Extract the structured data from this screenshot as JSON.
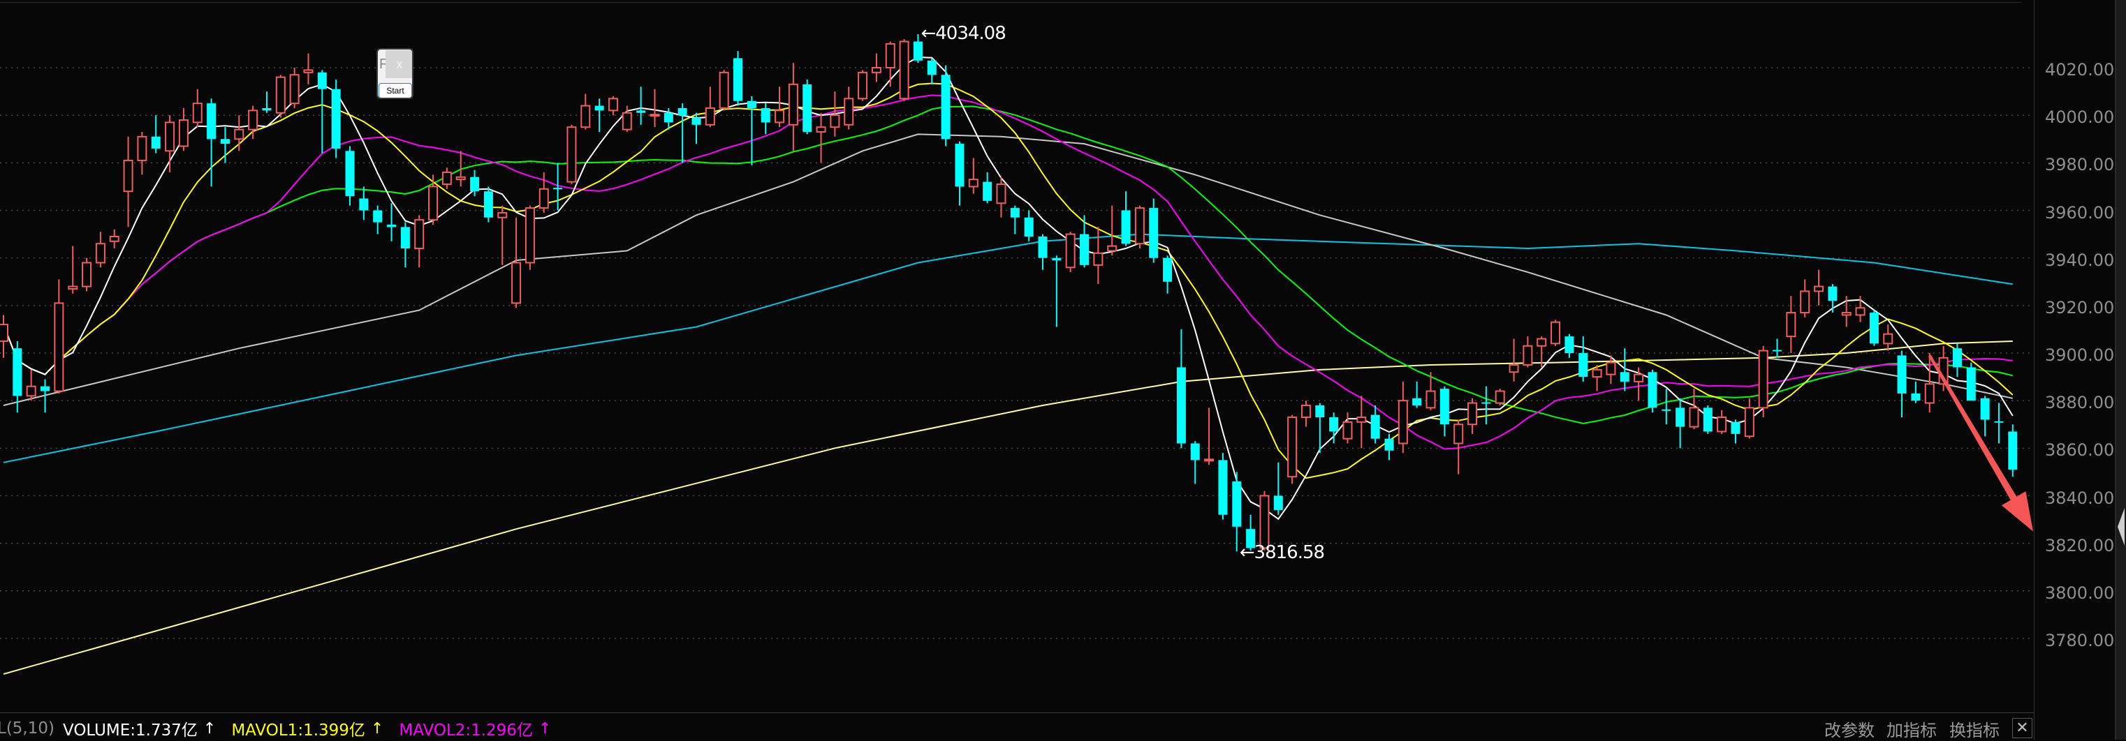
{
  "chart_data": {
    "type": "candlestick",
    "y_axis": {
      "ticks": [
        "4020.00",
        "4000.00",
        "3980.00",
        "3960.00",
        "3940.00",
        "3920.00",
        "3900.00",
        "3880.00",
        "3860.00",
        "3840.00",
        "3820.00",
        "3800.00",
        "3780.00"
      ],
      "tick_values": [
        4020,
        4000,
        3980,
        3960,
        3940,
        3920,
        3900,
        3880,
        3860,
        3840,
        3820,
        3800,
        3780
      ],
      "position": "right",
      "grid": "dotted"
    },
    "ylim": [
      3766,
      4048
    ],
    "colors": {
      "up": "#f25c5c",
      "down": "#00ffff",
      "ma5": "#ffffff",
      "ma10": "#ffff00",
      "ma20": "#ff00ff",
      "ma30": "#00ff00",
      "ma60": "#c8c8c8",
      "ma120": "#00c8e6",
      "ma250": "#ffff90",
      "arrow": "#f55555"
    },
    "ohlc_format": [
      "open",
      "high",
      "low",
      "close"
    ],
    "ohlc": [
      [
        3905,
        3916,
        3898,
        3912
      ],
      [
        3902,
        3905,
        3875,
        3882
      ],
      [
        3882,
        3893,
        3880,
        3886
      ],
      [
        3886,
        3889,
        3875,
        3884
      ],
      [
        3884,
        3931,
        3883,
        3921
      ],
      [
        3927,
        3945,
        3925,
        3928
      ],
      [
        3928,
        3940,
        3926,
        3938
      ],
      [
        3938,
        3951,
        3936,
        3946
      ],
      [
        3947,
        3952,
        3944,
        3949
      ],
      [
        3968,
        3991,
        3953,
        3981
      ],
      [
        3981,
        3993,
        3975,
        3991
      ],
      [
        3991,
        4000,
        3984,
        3986
      ],
      [
        3985,
        4000,
        3976,
        3997
      ],
      [
        3987,
        4003,
        3985,
        3998
      ],
      [
        3997,
        4011,
        3995,
        4005
      ],
      [
        4005,
        4007,
        3970,
        3990
      ],
      [
        3990,
        3995,
        3980,
        3988
      ],
      [
        3990,
        4000,
        3985,
        3994
      ],
      [
        3994,
        4004,
        3990,
        4002
      ],
      [
        4003,
        4010,
        4001,
        4002
      ],
      [
        4001,
        4017,
        3999,
        4016
      ],
      [
        4005,
        4020,
        4003,
        4017
      ],
      [
        4018,
        4026,
        4013,
        4019
      ],
      [
        4018,
        4019,
        3984,
        4011
      ],
      [
        4011,
        4015,
        3982,
        3986
      ],
      [
        3985,
        3987,
        3962,
        3966
      ],
      [
        3965,
        3970,
        3956,
        3960
      ],
      [
        3960,
        3962,
        3950,
        3955
      ],
      [
        3954,
        3963,
        3947,
        3953
      ],
      [
        3953,
        3955,
        3936,
        3944
      ],
      [
        3944,
        3958,
        3936,
        3956
      ],
      [
        3956,
        3975,
        3954,
        3970
      ],
      [
        3971,
        3978,
        3969,
        3976
      ],
      [
        3973,
        3985,
        3970,
        3974
      ],
      [
        3974,
        3977,
        3966,
        3968
      ],
      [
        3968,
        3970,
        3955,
        3957
      ],
      [
        3957,
        3962,
        3937,
        3959
      ],
      [
        3921,
        3957,
        3919,
        3938
      ],
      [
        3938,
        3962,
        3935,
        3961
      ],
      [
        3961,
        3976,
        3959,
        3969
      ],
      [
        3969.5,
        3980,
        3960,
        3969
      ],
      [
        3972,
        3996,
        3971,
        3995
      ],
      [
        3995,
        4009,
        3994,
        4004
      ],
      [
        4004,
        4007,
        3993,
        4002
      ],
      [
        4002,
        4008,
        4000,
        4007
      ],
      [
        3994,
        4004,
        3993,
        4001
      ],
      [
        4002,
        4012,
        3996,
        4001
      ],
      [
        4000,
        4011,
        3995,
        4000.3
      ],
      [
        4001,
        4003,
        3994,
        3997
      ],
      [
        4003,
        4005,
        3980,
        4000
      ],
      [
        3999,
        4001,
        3988,
        3996
      ],
      [
        3996,
        4012,
        3995,
        4003
      ],
      [
        4003,
        4019,
        4002,
        4018
      ],
      [
        4024,
        4027,
        4004,
        4006
      ],
      [
        4006,
        4008,
        3979,
        4003
      ],
      [
        4003,
        4005,
        3992,
        3997
      ],
      [
        3997,
        4012,
        3995,
        4002
      ],
      [
        3996,
        4022,
        3985,
        4013
      ],
      [
        4013,
        4015,
        3992,
        3993
      ],
      [
        3993,
        4001,
        3980,
        3995
      ],
      [
        3995,
        4010,
        3991,
        4000
      ],
      [
        3996,
        4012,
        3994,
        4007
      ],
      [
        4007,
        4019,
        4006,
        4018
      ],
      [
        4018,
        4026,
        4014,
        4020
      ],
      [
        4020,
        4031,
        4012,
        4030
      ],
      [
        4007,
        4032,
        4006,
        4031
      ],
      [
        4031,
        4034.08,
        4022,
        4023
      ],
      [
        4023,
        4024,
        4013,
        4017
      ],
      [
        4017,
        4021,
        3987,
        3990
      ],
      [
        3988,
        3989,
        3962,
        3970
      ],
      [
        3970,
        3982,
        3967,
        3973
      ],
      [
        3972,
        3976,
        3963,
        3964
      ],
      [
        3963,
        3974,
        3957,
        3971
      ],
      [
        3961,
        3962,
        3950,
        3957
      ],
      [
        3957,
        3960,
        3947,
        3949
      ],
      [
        3949,
        3950,
        3935,
        3940
      ],
      [
        3940,
        3941,
        3911,
        3939
      ],
      [
        3936,
        3951,
        3934,
        3950
      ],
      [
        3950,
        3958,
        3936,
        3937
      ],
      [
        3937,
        3953,
        3929,
        3942
      ],
      [
        3943,
        3962,
        3941,
        3945
      ],
      [
        3960,
        3968,
        3945,
        3946
      ],
      [
        3946,
        3962,
        3944,
        3961
      ],
      [
        3961,
        3965,
        3938,
        3940
      ],
      [
        3940,
        3941,
        3925,
        3930
      ],
      [
        3894,
        3910,
        3860,
        3862
      ],
      [
        3862,
        3863,
        3845,
        3855
      ],
      [
        3855,
        3877,
        3853,
        3855.3
      ],
      [
        3855,
        3858,
        3830,
        3832
      ],
      [
        3846,
        3850,
        3816.58,
        3827
      ],
      [
        3826,
        3832,
        3817,
        3818
      ],
      [
        3818,
        3842,
        3817,
        3840
      ],
      [
        3840,
        3854,
        3832,
        3834
      ],
      [
        3848,
        3874,
        3845,
        3873
      ],
      [
        3873,
        3880,
        3869,
        3878
      ],
      [
        3878,
        3879,
        3858,
        3873
      ],
      [
        3873,
        3875,
        3862,
        3867
      ],
      [
        3864,
        3875,
        3862,
        3871
      ],
      [
        3871,
        3882,
        3860,
        3873
      ],
      [
        3874,
        3878,
        3862,
        3864
      ],
      [
        3864,
        3866,
        3855,
        3859
      ],
      [
        3862,
        3888,
        3858,
        3880
      ],
      [
        3881,
        3888,
        3877,
        3878
      ],
      [
        3877,
        3892,
        3876,
        3884
      ],
      [
        3885,
        3886,
        3865,
        3870
      ],
      [
        3862,
        3872,
        3849,
        3870
      ],
      [
        3870,
        3881,
        3866,
        3879
      ],
      [
        3879.3,
        3886,
        3870,
        3879
      ],
      [
        3879,
        3885,
        3878,
        3884
      ],
      [
        3892,
        3906,
        3888,
        3895
      ],
      [
        3895,
        3907,
        3894,
        3903
      ],
      [
        3903,
        3907,
        3894,
        3906
      ],
      [
        3904,
        3914,
        3903,
        3913
      ],
      [
        3907,
        3908,
        3898,
        3900
      ],
      [
        3900,
        3907,
        3888,
        3890
      ],
      [
        3890,
        3895,
        3884,
        3893
      ],
      [
        3891,
        3899,
        3887,
        3896
      ],
      [
        3892,
        3902,
        3884,
        3888
      ],
      [
        3888,
        3894,
        3880,
        3891
      ],
      [
        3892,
        3893,
        3875,
        3877
      ],
      [
        3876.3,
        3885,
        3870,
        3876
      ],
      [
        3877,
        3881,
        3860,
        3869
      ],
      [
        3869,
        3885,
        3868,
        3877
      ],
      [
        3877,
        3878,
        3866,
        3867
      ],
      [
        3867,
        3876,
        3866,
        3873
      ],
      [
        3871,
        3872,
        3862,
        3866
      ],
      [
        3865,
        3881,
        3864,
        3877
      ],
      [
        3877,
        3903,
        3873,
        3901
      ],
      [
        3901.3,
        3906,
        3898,
        3901
      ],
      [
        3907,
        3924,
        3900,
        3917
      ],
      [
        3917,
        3931,
        3915,
        3926
      ],
      [
        3926,
        3935,
        3920,
        3928
      ],
      [
        3928,
        3929,
        3917,
        3922
      ],
      [
        3916,
        3924,
        3911,
        3917
      ],
      [
        3916,
        3924,
        3913,
        3919
      ],
      [
        3917,
        3918,
        3903,
        3904
      ],
      [
        3904,
        3912,
        3901,
        3908
      ],
      [
        3899,
        3901,
        3873,
        3883
      ],
      [
        3883,
        3888,
        3879,
        3880
      ],
      [
        3879,
        3900,
        3875,
        3887
      ],
      [
        3887,
        3903,
        3884,
        3898
      ],
      [
        3902,
        3904,
        3890,
        3894
      ],
      [
        3894,
        3896,
        3880,
        3880
      ],
      [
        3881,
        3882,
        3865,
        3872
      ],
      [
        3871.3,
        3879,
        3862,
        3871
      ],
      [
        3867,
        3870,
        3848,
        3851
      ]
    ],
    "ma_computed_periods": [
      5,
      10,
      20,
      30
    ],
    "ma_long": {
      "ma60": [
        [
          0,
          3878
        ],
        [
          17,
          3902
        ],
        [
          30,
          3918
        ],
        [
          37,
          3939
        ],
        [
          45,
          3943
        ],
        [
          50,
          3958
        ],
        [
          57,
          3972
        ],
        [
          62,
          3985
        ],
        [
          66,
          3992
        ],
        [
          72,
          3991
        ],
        [
          78,
          3988
        ],
        [
          86,
          3975
        ],
        [
          95,
          3958
        ],
        [
          104,
          3944
        ],
        [
          110,
          3934
        ],
        [
          120,
          3916
        ],
        [
          127,
          3898
        ],
        [
          133,
          3894
        ],
        [
          140,
          3887
        ],
        [
          145,
          3881
        ]
      ],
      "ma120": [
        [
          0,
          3854
        ],
        [
          11,
          3867
        ],
        [
          37,
          3899
        ],
        [
          50,
          3911
        ],
        [
          66,
          3938
        ],
        [
          75,
          3947
        ],
        [
          82,
          3950
        ],
        [
          90,
          3948
        ],
        [
          100,
          3946
        ],
        [
          110,
          3944
        ],
        [
          118,
          3946
        ],
        [
          125,
          3943
        ],
        [
          135,
          3938
        ],
        [
          145,
          3929
        ]
      ],
      "ma250": [
        [
          0,
          3765
        ],
        [
          37,
          3826
        ],
        [
          60,
          3860
        ],
        [
          75,
          3878
        ],
        [
          85,
          3888
        ],
        [
          95,
          3893
        ],
        [
          103,
          3895
        ],
        [
          112,
          3896
        ],
        [
          127,
          3898
        ],
        [
          133,
          3900
        ],
        [
          140,
          3904
        ],
        [
          145,
          3905
        ]
      ]
    },
    "annotations": {
      "high": {
        "bar": 66,
        "value": 4034.08,
        "label": "4034.08"
      },
      "low": {
        "bar": 89,
        "value": 3816.58,
        "label": "3816.58"
      }
    },
    "trend_arrow": {
      "from": {
        "bar": 139,
        "value": 3899
      },
      "to_value": 3825,
      "direction": "down"
    }
  },
  "indicator_bar": {
    "params": "L(5,10)",
    "volume": "VOLUME:1.737亿",
    "mavol1": "MAVOL1:1.399亿",
    "mavol2": "MAVOL2:1.296亿",
    "arrow": "↑",
    "buttons": {
      "modify_params": "改参数",
      "add_indicator": "加指标",
      "switch_indicator": "换指标",
      "close": "✕"
    }
  },
  "widget": {
    "letter": "F",
    "image_glyph": "x",
    "start_label": "Start"
  }
}
